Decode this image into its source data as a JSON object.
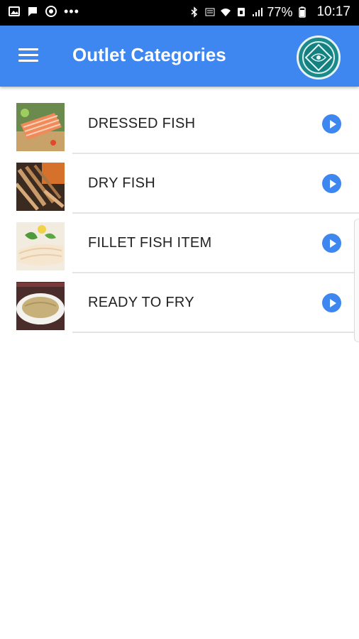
{
  "status_bar": {
    "time": "10:17",
    "battery": "77%",
    "left_icons": [
      "image-icon",
      "message-icon",
      "chrome-icon",
      "more-dots-icon"
    ],
    "right_icons": [
      "bluetooth-icon",
      "volte-icon",
      "wifi-icon",
      "sim-icon",
      "signal-icon",
      "battery-icon"
    ]
  },
  "app_bar": {
    "title": "Outlet Categories",
    "menu_icon": "hamburger-menu-icon",
    "logo_icon": "brand-logo-icon",
    "color": "#3e86f0"
  },
  "categories": [
    {
      "label": "DRESSED FISH",
      "image": "salmon-fillet-image"
    },
    {
      "label": "DRY FISH",
      "image": "dried-fish-image"
    },
    {
      "label": "FILLET FISH ITEM",
      "image": "white-fish-fillet-image"
    },
    {
      "label": "READY TO FRY",
      "image": "breaded-fish-image"
    }
  ],
  "accent_color": "#3e86f0"
}
